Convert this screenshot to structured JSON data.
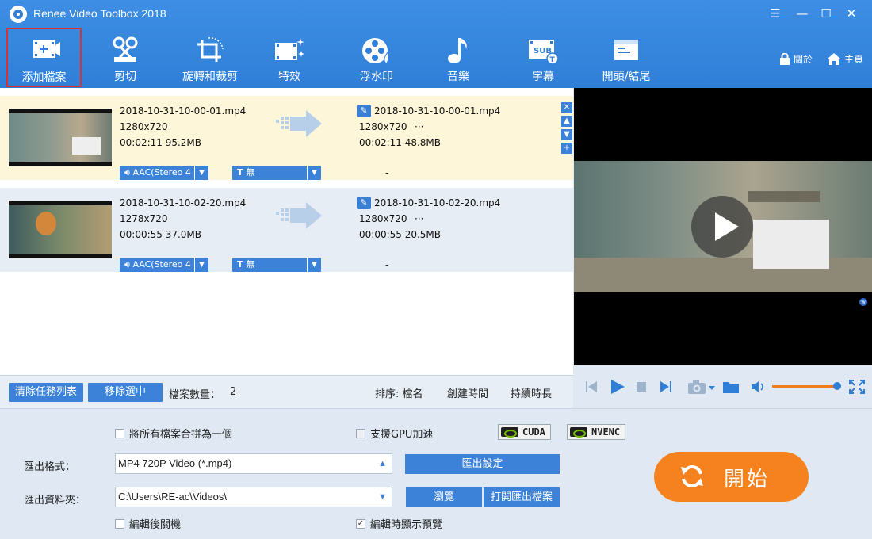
{
  "window": {
    "title": "Renee Video Toolbox 2018"
  },
  "toolbar": {
    "add_files": "添加檔案",
    "cut": "剪切",
    "rotate_crop": "旋轉和裁剪",
    "effects": "特效",
    "watermark": "浮水印",
    "music": "音樂",
    "subtitle": "字幕",
    "opening_ending": "開頭/結尾",
    "lock": "關於",
    "home": "主頁"
  },
  "files": [
    {
      "src_name": "2018-10-31-10-00-01.mp4",
      "src_res": "1280x720",
      "src_info": "00:02:11  95.2MB",
      "out_name": "2018-10-31-10-00-01.mp4",
      "out_res": "1280x720",
      "out_more": "···",
      "out_info": "00:02:11  48.8MB",
      "audio": "AAC(Stereo 4",
      "subtitle": "無",
      "dash": "-"
    },
    {
      "src_name": "2018-10-31-10-02-20.mp4",
      "src_res": "1278x720",
      "src_info": "00:00:55  37.0MB",
      "out_name": "2018-10-31-10-02-20.mp4",
      "out_res": "1280x720",
      "out_more": "···",
      "out_info": "00:00:55  20.5MB",
      "audio": "AAC(Stereo 4",
      "subtitle": "無",
      "dash": "-"
    }
  ],
  "listbar": {
    "clear": "清除任務列表",
    "remove": "移除選中",
    "count_label": "檔案數量：",
    "count": "2",
    "sort_label": "排序: 檔名",
    "sort_created": "創建時間",
    "sort_duration": "持續時長"
  },
  "settings": {
    "merge_label": "將所有檔案合拼為一個",
    "gpu_label": "支援GPU加速",
    "cuda": "CUDA",
    "nvenc": "NVENC",
    "format_label": "匯出格式：",
    "format_value": "MP4 720P Video (*.mp4)",
    "export_settings": "匯出設定",
    "folder_label": "匯出資料夾：",
    "folder_value": "C:\\Users\\RE-ac\\Videos\\",
    "browse": "瀏覽",
    "open_folder": "打開匯出檔案",
    "shutdown_label": "編輯後關機",
    "preview_label": "編輯時顯示預覽",
    "preview_checked": true,
    "start": "開始"
  },
  "colors": {
    "accent": "#3b82d8",
    "start": "#f5821f",
    "toolbar": "#2f7fd8",
    "highlight": "#e0302b"
  }
}
